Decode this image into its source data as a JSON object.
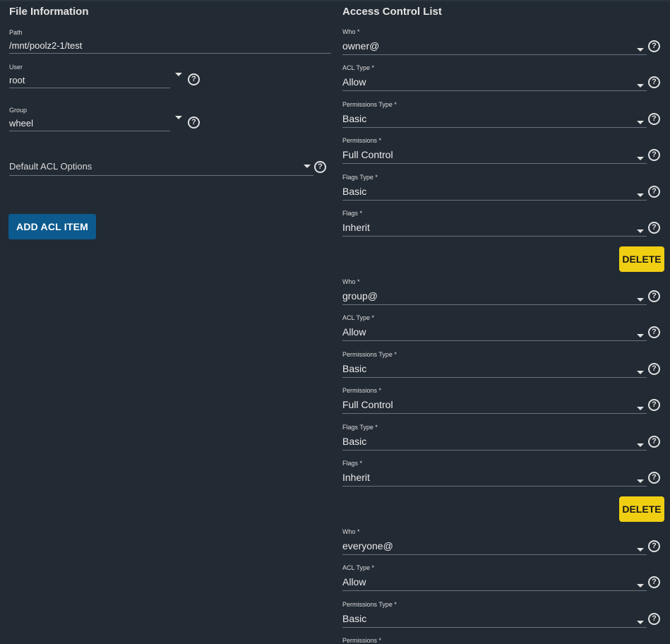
{
  "file_info": {
    "title": "File Information",
    "path": {
      "label": "Path",
      "value": "/mnt/poolz2-1/test"
    },
    "user": {
      "label": "User",
      "value": "root"
    },
    "group": {
      "label": "Group",
      "value": "wheel"
    },
    "default_acl": {
      "placeholder": "Default ACL Options"
    },
    "add_button": "ADD ACL ITEM"
  },
  "acl": {
    "title": "Access Control List",
    "delete_label": "DELETE",
    "help_glyph": "?",
    "entries": [
      {
        "who_label": "Who *",
        "who": "owner@",
        "type_label": "ACL Type *",
        "type": "Allow",
        "perm_type_label": "Permissions Type *",
        "perm_type": "Basic",
        "perm_label": "Permissions *",
        "perm": "Full Control",
        "flags_type_label": "Flags Type *",
        "flags_type": "Basic",
        "flags_label": "Flags *",
        "flags": "Inherit"
      },
      {
        "who_label": "Who *",
        "who": "group@",
        "type_label": "ACL Type *",
        "type": "Allow",
        "perm_type_label": "Permissions Type *",
        "perm_type": "Basic",
        "perm_label": "Permissions *",
        "perm": "Full Control",
        "flags_type_label": "Flags Type *",
        "flags_type": "Basic",
        "flags_label": "Flags *",
        "flags": "Inherit"
      },
      {
        "who_label": "Who *",
        "who": "everyone@",
        "type_label": "ACL Type *",
        "type": "Allow",
        "perm_type_label": "Permissions Type *",
        "perm_type": "Basic",
        "perm_label": "Permissions *"
      }
    ]
  },
  "icons": {
    "help": "help-circle-icon",
    "dropdown": "caret-down-icon"
  }
}
